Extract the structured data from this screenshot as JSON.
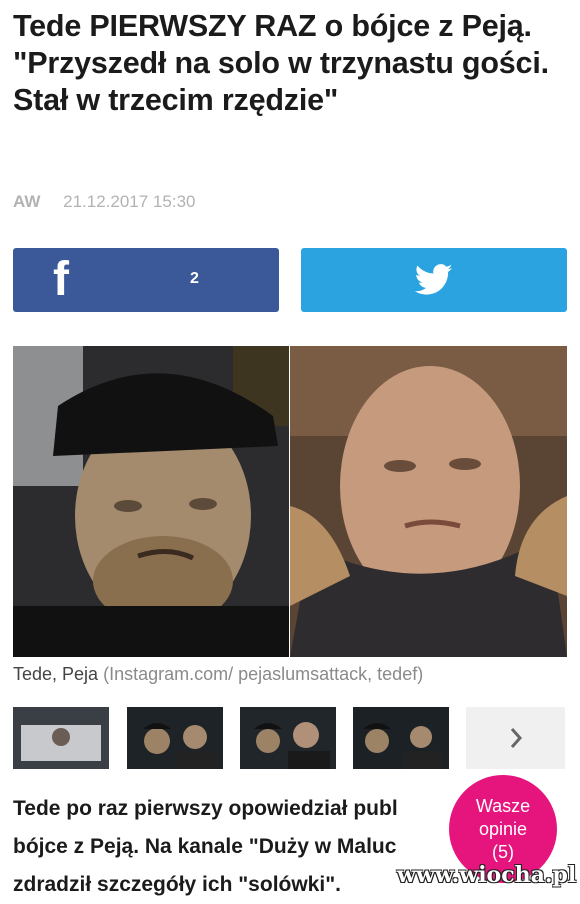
{
  "article": {
    "title": "Tede PIERWSZY RAZ o bójce z Peją. \"Przyszedł na solo w trzynastu gości. Stał w trzecim rzędzie\"",
    "author": "AW",
    "date": "21.12.2017 15:30"
  },
  "share": {
    "facebook_icon": "facebook-icon",
    "facebook_count": "2",
    "twitter_icon": "twitter-icon",
    "facebook_color": "#3b5998",
    "twitter_color": "#2aa3e0"
  },
  "photo": {
    "caption_names": "Tede, Peja",
    "caption_source": "(Instagram.com/ pejaslumsattack, tedef)"
  },
  "gallery": {
    "next_icon": "chevron-right-icon",
    "thumbnail_count": 4
  },
  "lead": {
    "line1": "Tede po raz pierwszy opowiedział publ",
    "line2": "bójce z Peją. Na kanale \"Duży w Maluc",
    "line3": "zdradził szczegóły ich \"solówki\"."
  },
  "comments": {
    "line1": "Wasze",
    "line2": "opinie",
    "count": "(5)",
    "color": "#e6157d"
  },
  "watermark": "www.wiocha.pl"
}
